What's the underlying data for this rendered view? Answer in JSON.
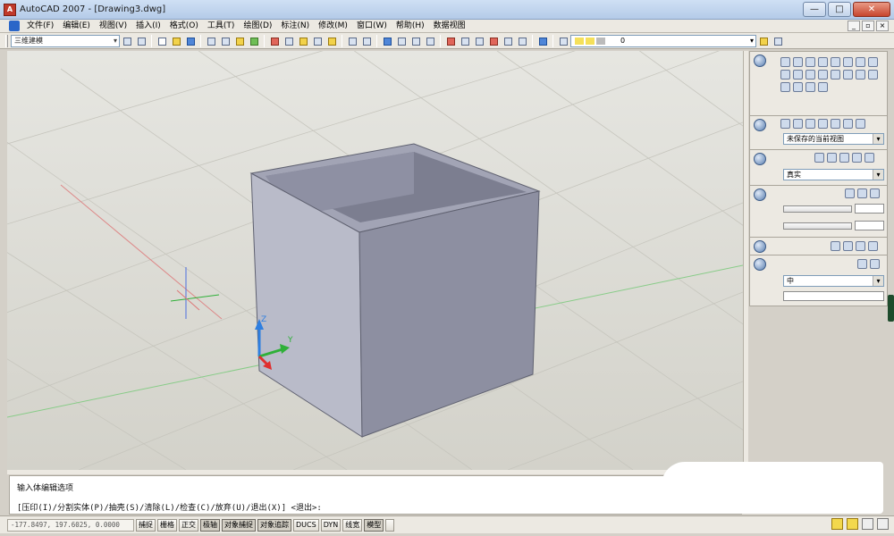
{
  "window": {
    "app_icon": "autocad-icon",
    "title": "AutoCAD 2007 - [Drawing3.dwg]",
    "buttons": [
      "—",
      "□",
      "✕"
    ]
  },
  "menubar": {
    "items": [
      "文件(F)",
      "编辑(E)",
      "视图(V)",
      "插入(I)",
      "格式(O)",
      "工具(T)",
      "绘图(D)",
      "标注(N)",
      "修改(M)",
      "窗口(W)",
      "帮助(H)",
      "数据视图"
    ],
    "mdi_buttons": [
      "_",
      "▫",
      "×"
    ]
  },
  "toolbar": {
    "workspace": "三维建模",
    "layer_value": "0"
  },
  "viewport": {
    "ucs_labels": {
      "z": "Z",
      "y": "Y"
    }
  },
  "dashboard": {
    "view_select": "未保存的当前视图",
    "visual_style_select": "真实",
    "quality_select": "中"
  },
  "command": {
    "line1": "输入体编辑选项",
    "line2": "[压印(I)/分割实体(P)/抽壳(S)/清除(L)/检查(C)/放弃(U)/退出(X)] <退出>:"
  },
  "statusbar": {
    "coords": "-177.8497, 197.6025, 0.0000",
    "toggles": [
      "捕捉",
      "栅格",
      "正交",
      "极轴",
      "对象捕捉",
      "对象追踪",
      "DUCS",
      "DYN",
      "线宽",
      "模型"
    ]
  }
}
